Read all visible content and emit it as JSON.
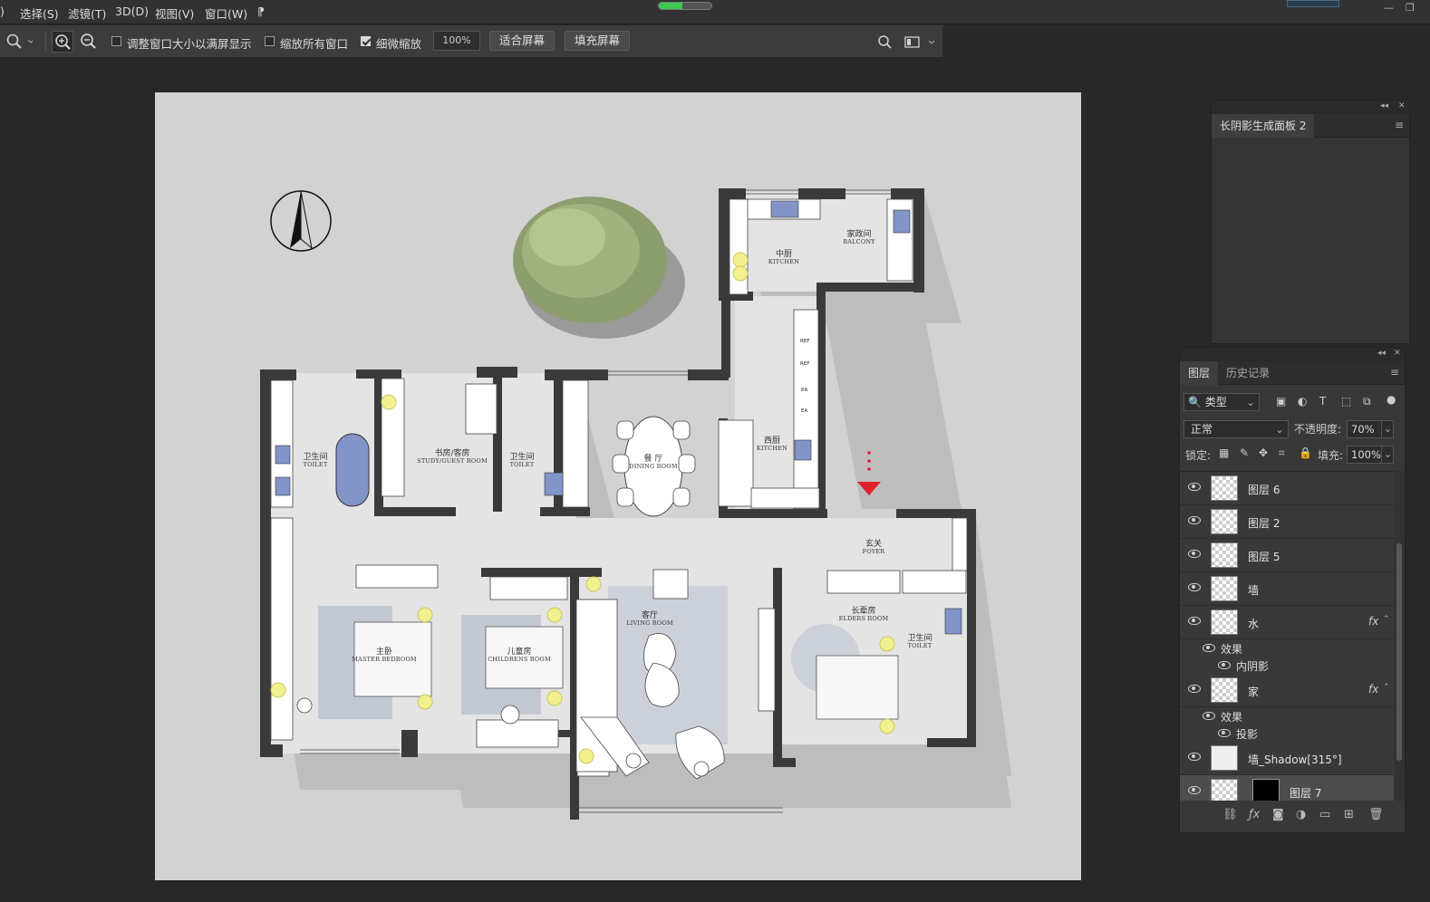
{
  "menubar": {
    "items": [
      "选择(S)",
      "滤镜(T)",
      "3D(D)",
      "视图(V)",
      "窗口(W)"
    ],
    "fragment_left": ")",
    "fragment_right": "⁋",
    "progress_fraction": 0.45
  },
  "options_bar": {
    "checkbox_fit_window": {
      "label": "调整窗口大小以满屏显示",
      "checked": false
    },
    "checkbox_zoom_all": {
      "label": "缩放所有窗口",
      "checked": false
    },
    "checkbox_scrubby": {
      "label": "细微缩放",
      "checked": true
    },
    "zoom_value": "100%",
    "fit_screen_label": "适合屏幕",
    "fill_screen_label": "填充屏幕"
  },
  "canvas": {
    "rooms": [
      {
        "zh": "中厨",
        "en": "KITCHEN"
      },
      {
        "zh": "家政间",
        "en": "BALCONY"
      },
      {
        "zh": "卫生间",
        "en": "TOILET"
      },
      {
        "zh": "书房/客房",
        "en": "STUDY/GUEST ROOM"
      },
      {
        "zh": "卫生间",
        "en": "TOILET"
      },
      {
        "zh": "餐 厅",
        "en": "DINING ROOM"
      },
      {
        "zh": "西厨",
        "en": "KITCHEN"
      },
      {
        "zh": "玄关",
        "en": "FOYER"
      },
      {
        "zh": "主卧",
        "en": "MASTER BEDROOM"
      },
      {
        "zh": "儿童房",
        "en": "CHILDRENS ROOM"
      },
      {
        "zh": "客厅",
        "en": "LIVING ROOM"
      },
      {
        "zh": "长辈房",
        "en": "ELDERS ROOM"
      },
      {
        "zh": "卫生间",
        "en": "TOILET"
      }
    ],
    "appliance_labels": [
      "REF",
      "REF",
      "EA",
      "EA"
    ]
  },
  "shadow_panel": {
    "tab": "长阴影生成面板 2"
  },
  "layers_panel": {
    "tabs": [
      "图层",
      "历史记录"
    ],
    "filter": "类型",
    "blend_mode": "正常",
    "opacity_label": "不透明度:",
    "opacity_value": "70%",
    "lock_label": "锁定:",
    "fill_label": "填充:",
    "fill_value": "100%",
    "layers": [
      {
        "name": "图层 6"
      },
      {
        "name": "图层 2"
      },
      {
        "name": "图层 5"
      },
      {
        "name": "墙"
      },
      {
        "name": "水",
        "fx": "fx",
        "effects_label": "效果",
        "effect": "内阴影"
      },
      {
        "name": "家",
        "fx": "fx",
        "effects_label": "效果",
        "effect": "投影"
      },
      {
        "name": "墙_Shadow[315°]"
      },
      {
        "name": "图层 7",
        "selected": true
      }
    ]
  },
  "colors": {
    "accent_red": "#e0202a",
    "water_blue": "#7e8fc9",
    "light_yellow": "#f2f08a",
    "progress_green": "#3ec850"
  }
}
